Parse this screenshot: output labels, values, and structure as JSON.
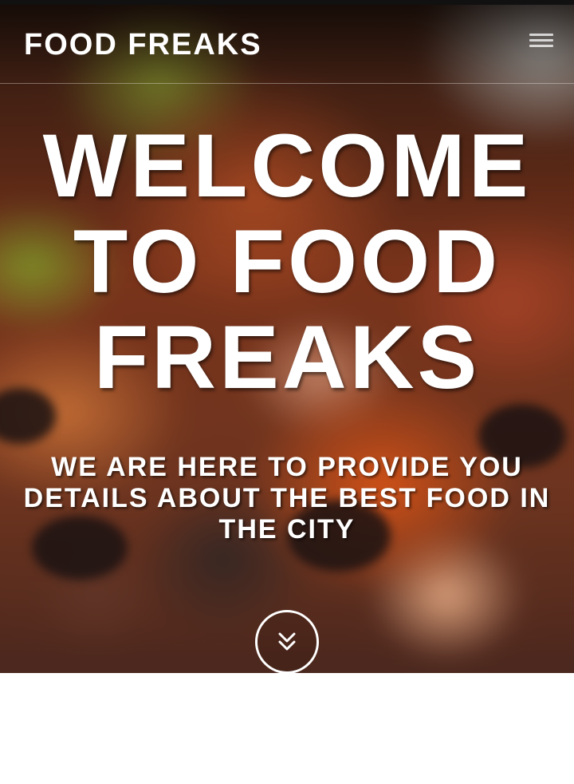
{
  "navbar": {
    "brand": "FOOD FREAKS",
    "menu_icon": "hamburger-menu-icon"
  },
  "hero": {
    "headline": "WELCOME TO FOOD FREAKS",
    "tagline": "WE ARE HERE TO PROVIDE YOU DETAILS ABOUT THE BEST FOOD IN THE CITY",
    "scroll_icon": "double-chevron-down-icon",
    "background_image": "blurred pizza close-up"
  },
  "colors": {
    "text": "#ffffff",
    "page_background": "#ffffff",
    "navbar_divider": "rgba(255,255,255,0.35)"
  }
}
